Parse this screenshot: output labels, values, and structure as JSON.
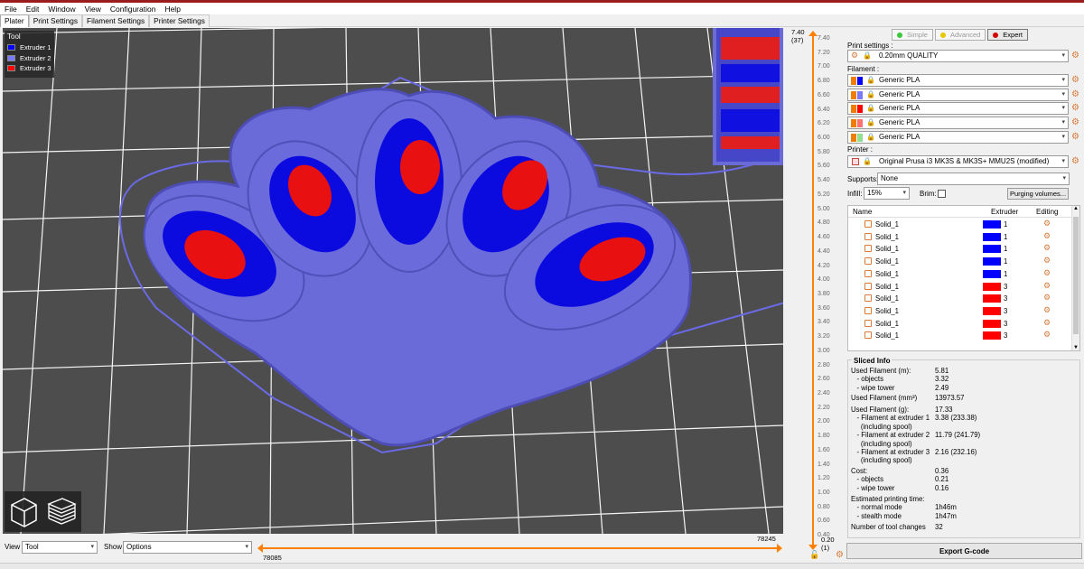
{
  "menu": [
    "File",
    "Edit",
    "Window",
    "View",
    "Configuration",
    "Help"
  ],
  "tabs": [
    "Plater",
    "Print Settings",
    "Filament Settings",
    "Printer Settings"
  ],
  "legend": {
    "title": "Tool",
    "items": [
      {
        "label": "Extruder 1",
        "color": "#0000ff"
      },
      {
        "label": "Extruder 2",
        "color": "#7a7aff"
      },
      {
        "label": "Extruder 3",
        "color": "#ff0000"
      }
    ]
  },
  "bottom": {
    "view_label": "View",
    "view_value": "Tool",
    "show_label": "Show",
    "show_value": "Options",
    "hslider_left": "78085",
    "hslider_right": "78245"
  },
  "vslider": {
    "top_value": "7.40",
    "top_layer": "(37)",
    "bottom_value": "0.20",
    "bottom_layer": "(1)",
    "ticks": [
      "7.40",
      "7.20",
      "7.00",
      "6.80",
      "6.60",
      "6.40",
      "6.20",
      "6.00",
      "5.80",
      "5.60",
      "5.40",
      "5.20",
      "5.00",
      "4.80",
      "4.60",
      "4.40",
      "4.20",
      "4.00",
      "3.80",
      "3.60",
      "3.40",
      "3.20",
      "3.00",
      "2.80",
      "2.60",
      "2.40",
      "2.20",
      "2.00",
      "1.80",
      "1.60",
      "1.40",
      "1.20",
      "1.00",
      "0.80",
      "0.60",
      "0.40"
    ]
  },
  "modes": [
    {
      "label": "Simple",
      "color": "#3cc83c",
      "active": false
    },
    {
      "label": "Advanced",
      "color": "#e6c800",
      "active": false
    },
    {
      "label": "Expert",
      "color": "#d20000",
      "active": true
    }
  ],
  "print_settings": {
    "label": "Print settings :",
    "value": "0.20mm QUALITY"
  },
  "filament": {
    "label": "Filament :",
    "items": [
      {
        "name": "Generic PLA",
        "color": "#0000ff"
      },
      {
        "name": "Generic PLA",
        "color": "#7a7aff"
      },
      {
        "name": "Generic PLA",
        "color": "#ff0000"
      },
      {
        "name": "Generic PLA",
        "color": "#ff7070"
      },
      {
        "name": "Generic PLA",
        "color": "#90e090"
      }
    ]
  },
  "printer": {
    "label": "Printer :",
    "value": "Original Prusa i3 MK3S & MK3S+ MMU2S (modified)"
  },
  "supports": {
    "label": "Supports:",
    "value": "None"
  },
  "infill": {
    "label": "Infill:",
    "value": "15%"
  },
  "brim": {
    "label": "Brim:"
  },
  "purging_button": "Purging volumes...",
  "objlist": {
    "headers": {
      "name": "Name",
      "extruder": "Extruder",
      "editing": "Editing"
    },
    "rows": [
      {
        "name": "Solid_1",
        "extruder": "1",
        "color": "#0000ff"
      },
      {
        "name": "Solid_1",
        "extruder": "1",
        "color": "#0000ff"
      },
      {
        "name": "Solid_1",
        "extruder": "1",
        "color": "#0000ff"
      },
      {
        "name": "Solid_1",
        "extruder": "1",
        "color": "#0000ff"
      },
      {
        "name": "Solid_1",
        "extruder": "1",
        "color": "#0000ff"
      },
      {
        "name": "Solid_1",
        "extruder": "3",
        "color": "#ff0000"
      },
      {
        "name": "Solid_1",
        "extruder": "3",
        "color": "#ff0000"
      },
      {
        "name": "Solid_1",
        "extruder": "3",
        "color": "#ff0000"
      },
      {
        "name": "Solid_1",
        "extruder": "3",
        "color": "#ff0000"
      },
      {
        "name": "Solid_1",
        "extruder": "3",
        "color": "#ff0000"
      }
    ]
  },
  "sliced_info": {
    "title": "Sliced Info",
    "rows": [
      {
        "label": "Used Filament (m):",
        "value": "5.81"
      },
      {
        "label": "   - objects",
        "value": "3.32"
      },
      {
        "label": "   - wipe tower",
        "value": "2.49"
      },
      {
        "label": "Used Filament (mm³)",
        "value": "13973.57"
      },
      {
        "label": "Used Filament (g):",
        "value": "17.33"
      },
      {
        "label": "   - Filament at extruder 1",
        "value": "3.38 (233.38)"
      },
      {
        "label": "     (including spool)",
        "value": ""
      },
      {
        "label": "   - Filament at extruder 2",
        "value": "11.79 (241.79)"
      },
      {
        "label": "     (including spool)",
        "value": ""
      },
      {
        "label": "   - Filament at extruder 3",
        "value": "2.16 (232.16)"
      },
      {
        "label": "     (including spool)",
        "value": ""
      },
      {
        "label": "Cost:",
        "value": "0.36"
      },
      {
        "label": "   - objects",
        "value": "0.21"
      },
      {
        "label": "   - wipe tower",
        "value": "0.16"
      },
      {
        "label": "Estimated printing time:",
        "value": ""
      },
      {
        "label": "   - normal mode",
        "value": "1h46m"
      },
      {
        "label": "   - stealth mode",
        "value": "1h47m"
      },
      {
        "label": "Number of tool changes",
        "value": "32"
      }
    ]
  },
  "export_button": "Export G-code",
  "icons": {
    "gear": "gear-icon",
    "lock": "lock-icon",
    "cube": "cube-3d-view-icon",
    "layers": "layers-view-icon"
  }
}
